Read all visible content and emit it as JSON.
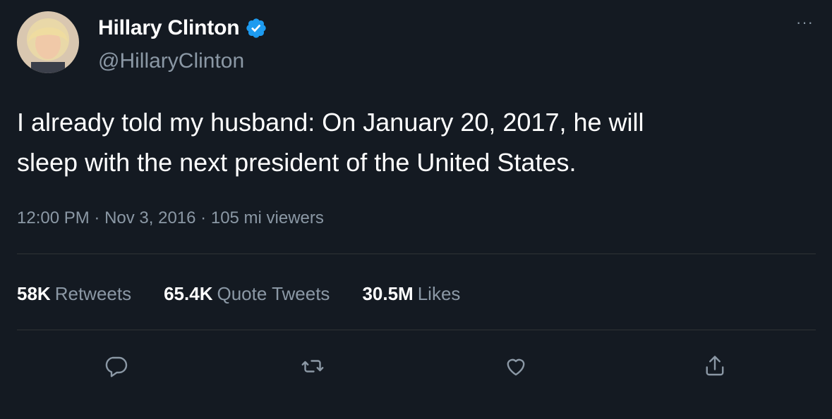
{
  "tweet": {
    "display_name": "Hillary Clinton",
    "handle": "@HillaryClinton",
    "more_label": "···",
    "text_line1": "I already told my husband: On January 20, 2017, he will",
    "text_line2": "sleep with the next president of the United States.",
    "timestamp": "12:00 PM",
    "date": "Nov 3, 2016",
    "views": "105 mi viewers",
    "separator": "·"
  },
  "stats": [
    {
      "value": "58K",
      "label": "Retweets"
    },
    {
      "value": "65.4K",
      "label": "Quote Tweets"
    },
    {
      "value": "30.5M",
      "label": "Likes"
    }
  ],
  "icons": {
    "verified": "verified-badge-icon",
    "reply": "reply-icon",
    "retweet": "retweet-icon",
    "like": "heart-icon",
    "share": "share-icon"
  },
  "colors": {
    "background": "#141a22",
    "text": "#ffffff",
    "secondary": "#8b98a5",
    "verified": "#1d9bf0",
    "divider": "#2f3336"
  }
}
